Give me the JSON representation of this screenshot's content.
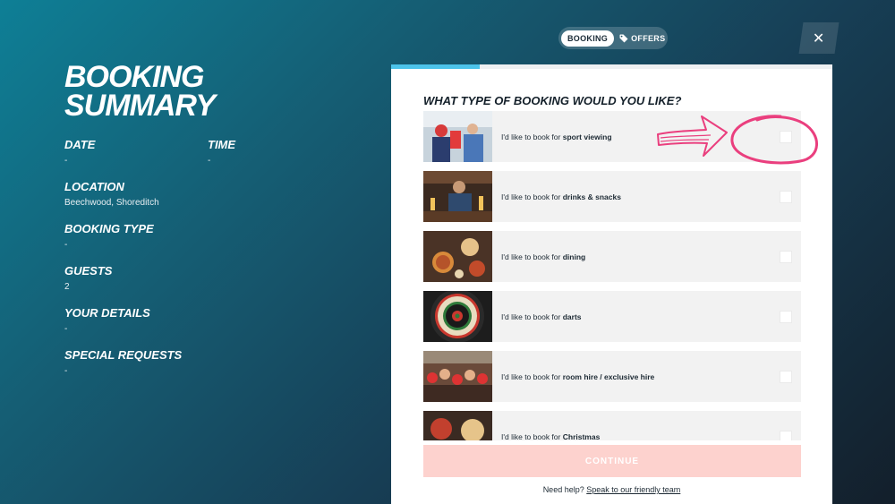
{
  "summary": {
    "title": "BOOKING SUMMARY",
    "date_label": "DATE",
    "date_value": "-",
    "time_label": "TIME",
    "time_value": "-",
    "location_label": "LOCATION",
    "location_value": "Beechwood, Shoreditch",
    "type_label": "BOOKING TYPE",
    "type_value": "-",
    "guests_label": "GUESTS",
    "guests_value": "2",
    "details_label": "YOUR DETAILS",
    "details_value": "-",
    "requests_label": "SPECIAL REQUESTS",
    "requests_value": "-"
  },
  "toggle": {
    "booking": "BOOKING",
    "offers": "OFFERS"
  },
  "close_symbol": "✕",
  "panel": {
    "progress": 0.2,
    "question": "WHAT TYPE OF BOOKING WOULD YOU LIKE?",
    "prefix": "I'd like to book for",
    "options": [
      {
        "label": "sport viewing"
      },
      {
        "label": "drinks & snacks"
      },
      {
        "label": "dining"
      },
      {
        "label": "darts"
      },
      {
        "label": "room hire / exclusive hire"
      },
      {
        "label": "Christmas"
      }
    ],
    "continue_label": "CONTINUE",
    "help_text": "Need help?",
    "help_link": "Speak to our friendly team"
  },
  "colors": {
    "accent": "#4cc3ea",
    "continue": "#fdd2ce",
    "annotation": "#ea3f7e"
  }
}
